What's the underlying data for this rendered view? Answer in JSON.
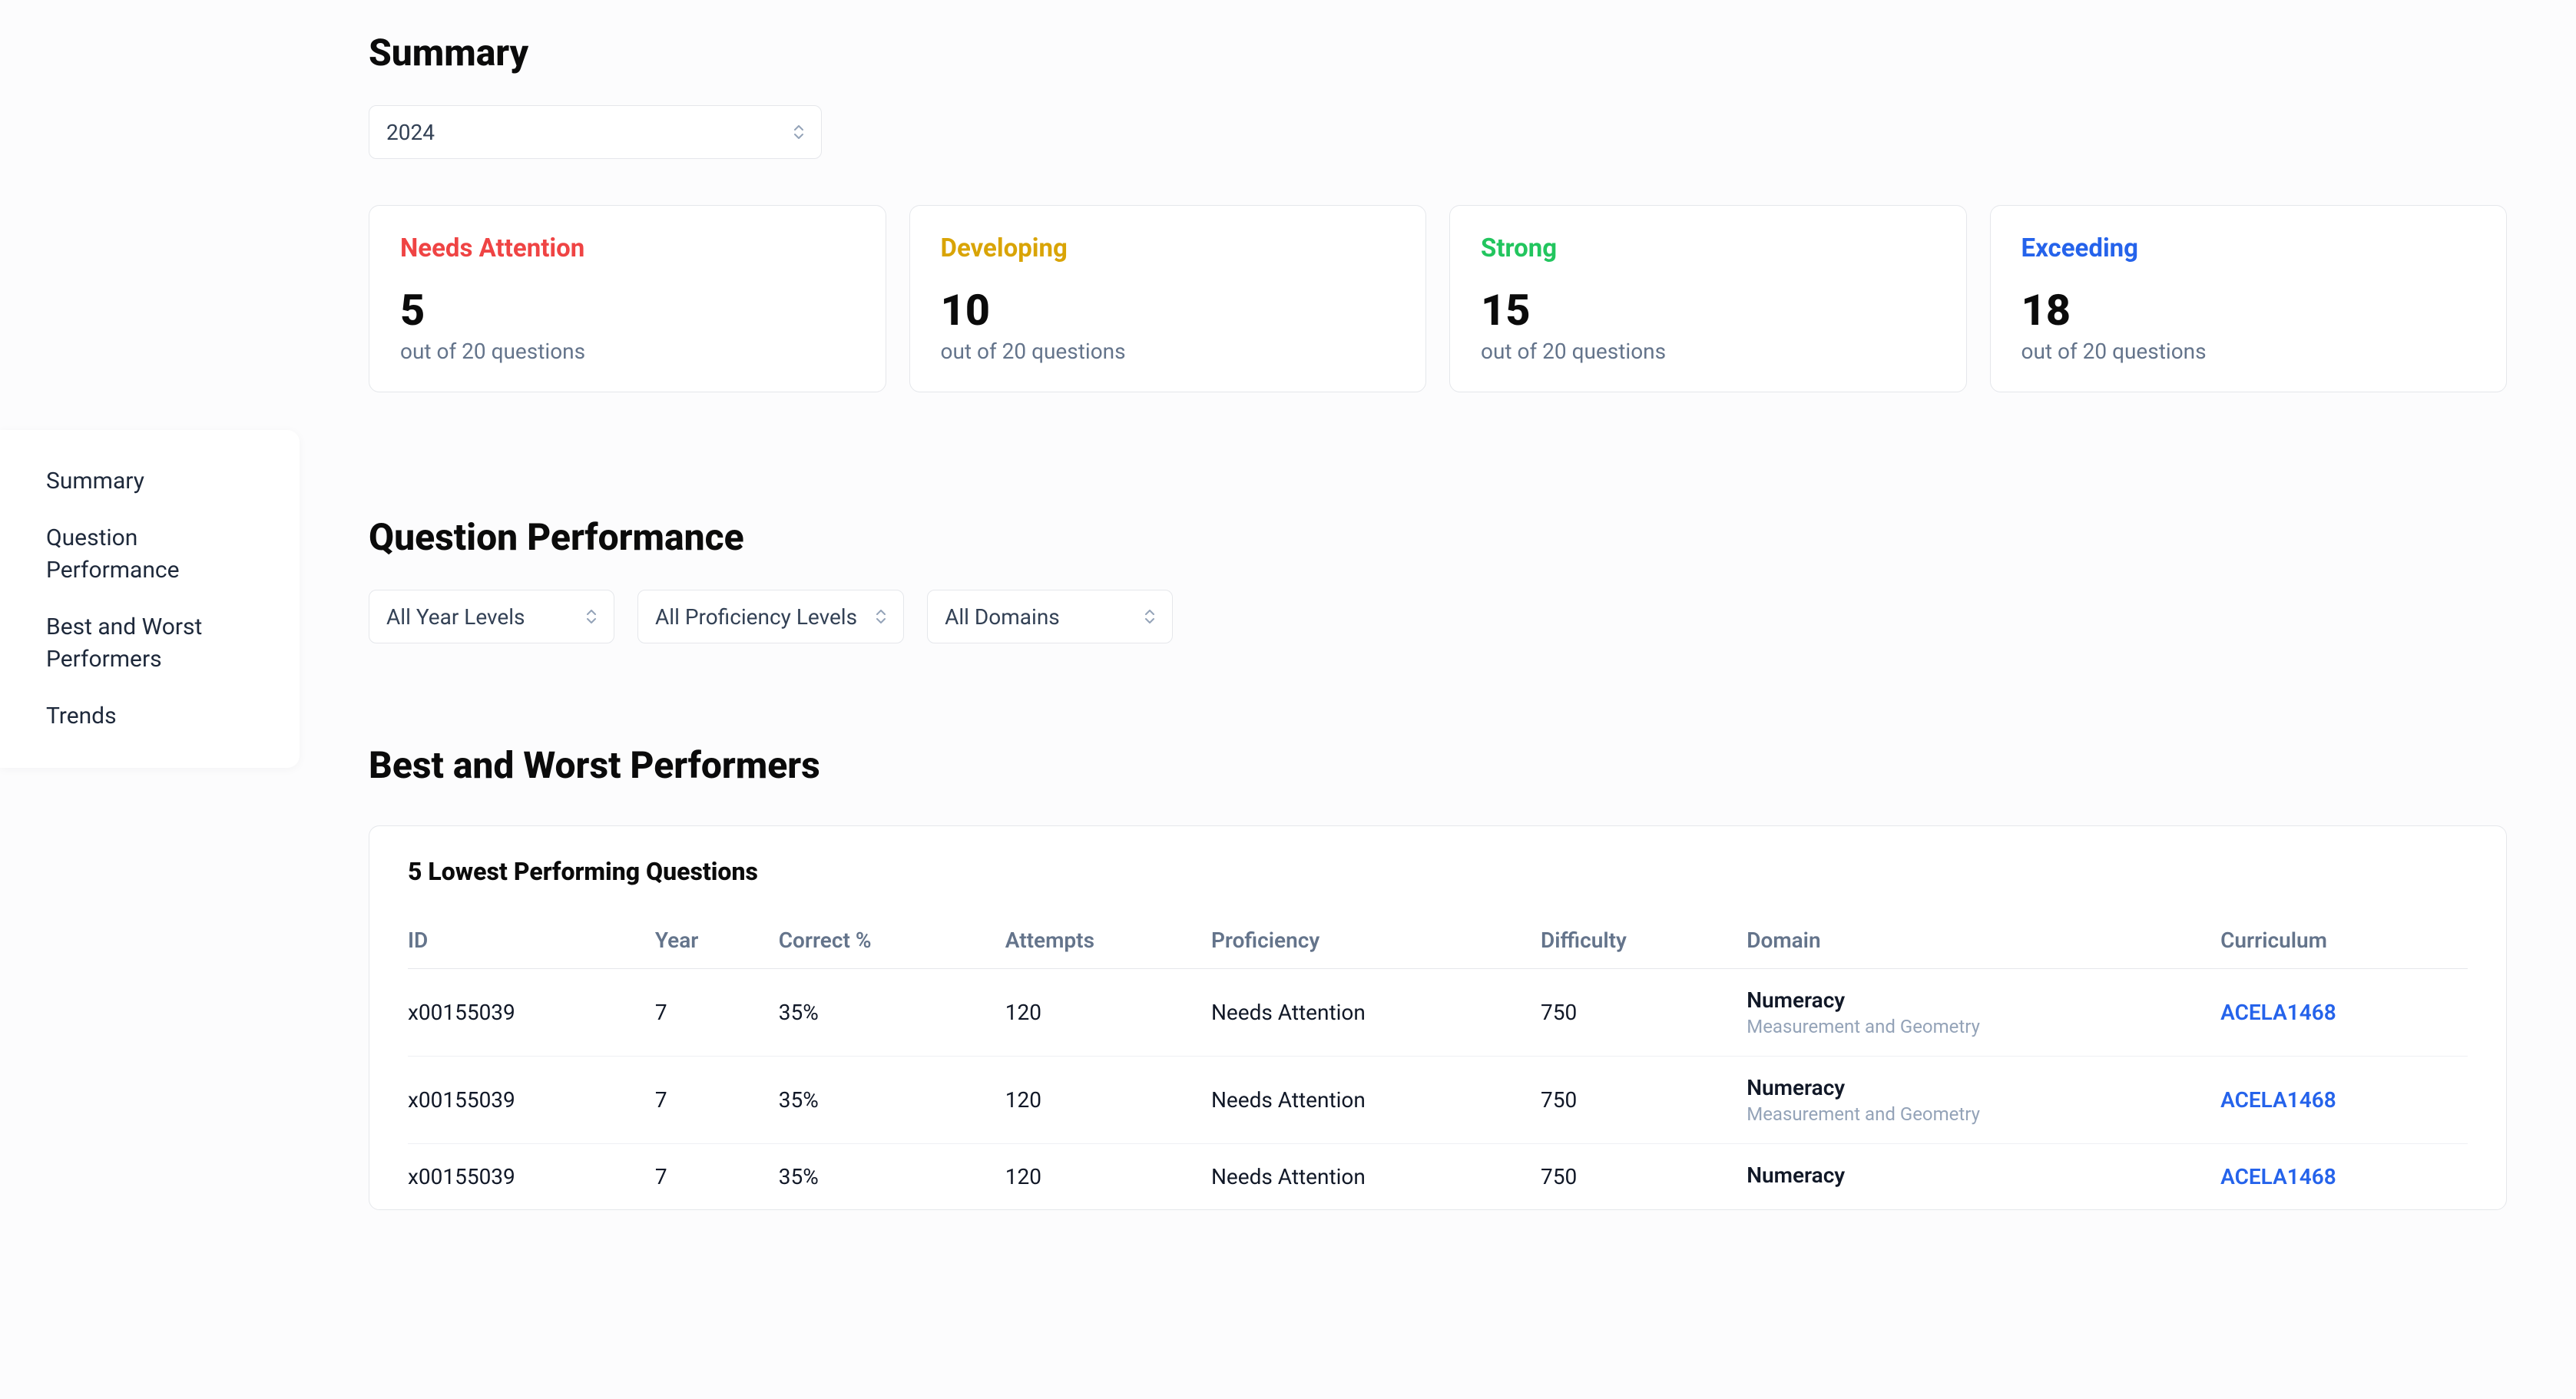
{
  "sidebar": {
    "items": [
      {
        "label": "Summary"
      },
      {
        "label": "Question Performance"
      },
      {
        "label": "Best and Worst Performers"
      },
      {
        "label": "Trends"
      }
    ]
  },
  "summary": {
    "title": "Summary",
    "year_select": "2024",
    "cards": [
      {
        "title": "Needs Attention",
        "value": "5",
        "sub": "out of 20 questions",
        "tone": "red"
      },
      {
        "title": "Developing",
        "value": "10",
        "sub": "out of 20 questions",
        "tone": "yellow"
      },
      {
        "title": "Strong",
        "value": "15",
        "sub": "out of 20 questions",
        "tone": "green"
      },
      {
        "title": "Exceeding",
        "value": "18",
        "sub": "out of 20 questions",
        "tone": "blue"
      }
    ]
  },
  "question_performance": {
    "title": "Question Performance",
    "filters": {
      "year_levels": "All Year Levels",
      "proficiency": "All Proficiency Levels",
      "domains": "All Domains"
    }
  },
  "performers": {
    "title": "Best and Worst Performers",
    "table_title": "5 Lowest Performing Questions",
    "columns": {
      "id": "ID",
      "year": "Year",
      "pct": "Correct %",
      "attempts": "Attempts",
      "proficiency": "Proficiency",
      "difficulty": "Difficulty",
      "domain": "Domain",
      "curriculum": "Curriculum"
    },
    "rows": [
      {
        "id": "x00155039",
        "year": "7",
        "pct": "35%",
        "attempts": "120",
        "proficiency": "Needs Attention",
        "difficulty": "750",
        "domain_main": "Numeracy",
        "domain_sub": "Measurement and Geometry",
        "curriculum": "ACELA1468"
      },
      {
        "id": "x00155039",
        "year": "7",
        "pct": "35%",
        "attempts": "120",
        "proficiency": "Needs Attention",
        "difficulty": "750",
        "domain_main": "Numeracy",
        "domain_sub": "Measurement and Geometry",
        "curriculum": "ACELA1468"
      },
      {
        "id": "x00155039",
        "year": "7",
        "pct": "35%",
        "attempts": "120",
        "proficiency": "Needs Attention",
        "difficulty": "750",
        "domain_main": "Numeracy",
        "domain_sub": "",
        "curriculum": "ACELA1468"
      }
    ]
  }
}
